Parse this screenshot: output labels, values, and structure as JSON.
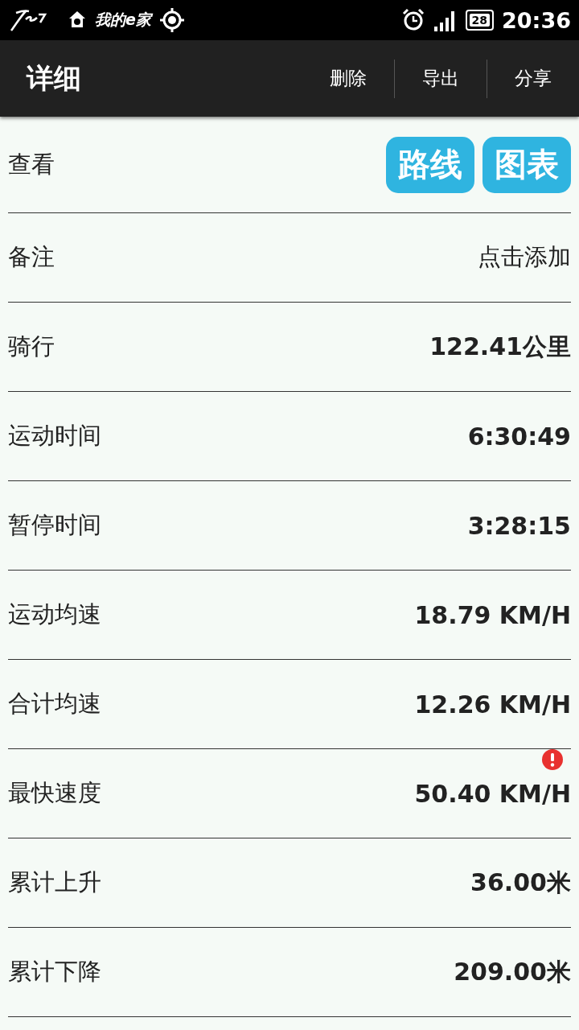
{
  "status_bar": {
    "app_label": "我的e家",
    "battery": "28",
    "time": "20:36"
  },
  "app_bar": {
    "title": "详细",
    "actions": [
      "删除",
      "导出",
      "分享"
    ]
  },
  "rows": [
    {
      "kind": "buttons",
      "label": "查看",
      "buttons": [
        "路线",
        "图表"
      ]
    },
    {
      "kind": "link",
      "label": "备注",
      "value": "点击添加"
    },
    {
      "kind": "value",
      "label": "骑行",
      "value": "122.41公里",
      "alert": false
    },
    {
      "kind": "value",
      "label": "运动时间",
      "value": "6:30:49",
      "alert": false
    },
    {
      "kind": "value",
      "label": "暂停时间",
      "value": "3:28:15",
      "alert": false
    },
    {
      "kind": "value",
      "label": "运动均速",
      "value": "18.79 KM/H",
      "alert": false
    },
    {
      "kind": "value",
      "label": "合计均速",
      "value": "12.26 KM/H",
      "alert": false
    },
    {
      "kind": "value",
      "label": "最快速度",
      "value": "50.40 KM/H",
      "alert": true
    },
    {
      "kind": "value",
      "label": "累计上升",
      "value": "36.00米",
      "alert": false
    },
    {
      "kind": "value",
      "label": "累计下降",
      "value": "209.00米",
      "alert": false
    }
  ]
}
